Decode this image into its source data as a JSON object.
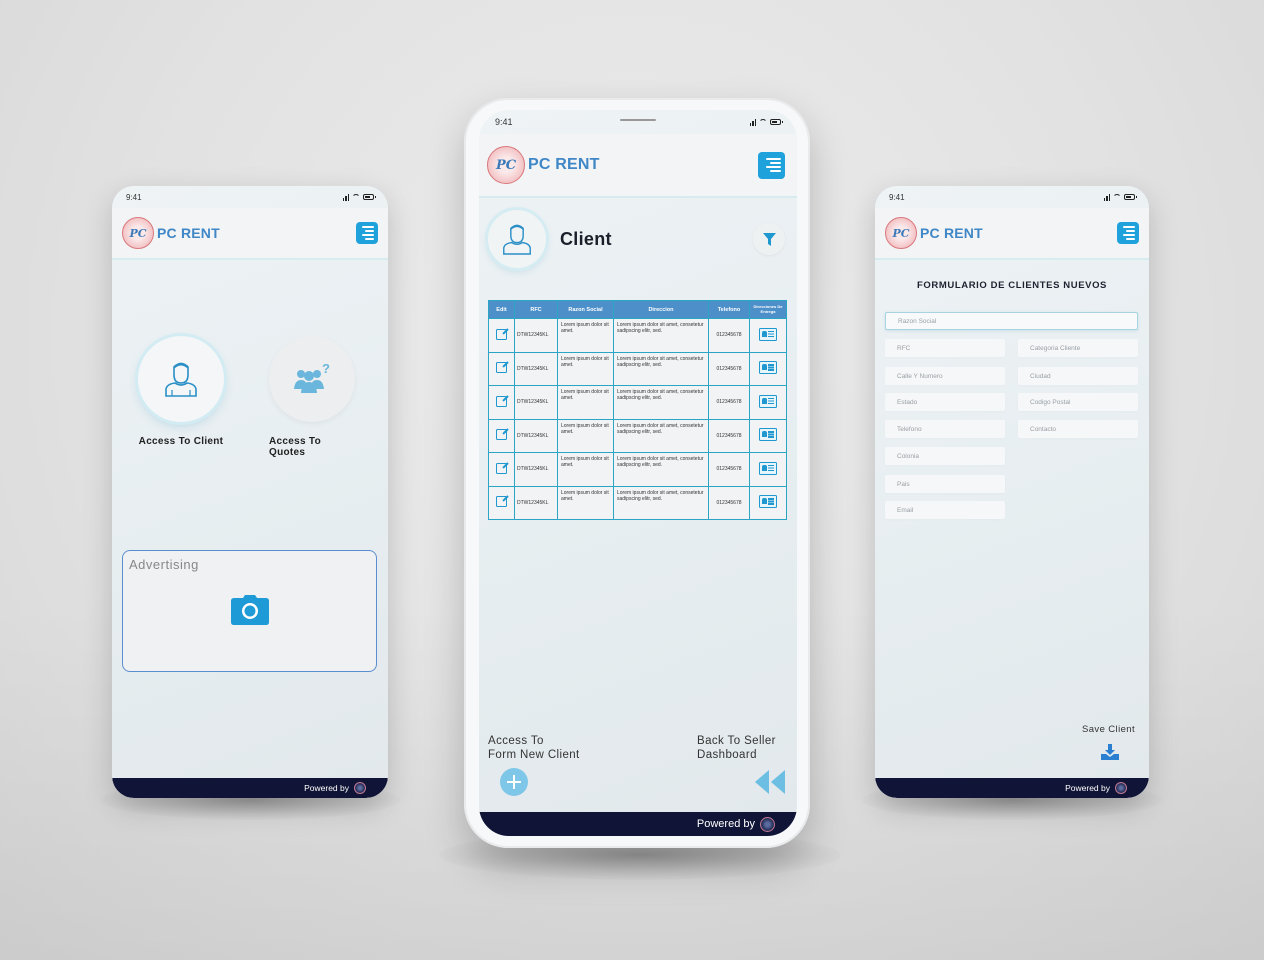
{
  "brand": {
    "name": "PC RENT",
    "logo_monogram": "PC",
    "accent_color": "#1fa2dc",
    "footer_color": "#101436"
  },
  "status_bar": {
    "time": "9:41"
  },
  "footer": {
    "powered_by": "Powered by"
  },
  "phones": {
    "home": {
      "menu_icon": "menu-icon",
      "buttons": [
        {
          "label": "Access To Client",
          "icon": "user-icon",
          "active": true
        },
        {
          "label": "Access To Quotes",
          "icon": "group-question-icon",
          "active": false
        }
      ],
      "advertising": {
        "label": "Advertising",
        "icon": "camera-icon"
      }
    },
    "client": {
      "title": "Client",
      "filter_icon": "filter-icon",
      "table": {
        "columns": [
          "Edit",
          "RFC",
          "Razon Social",
          "Direccion",
          "Telefono",
          "Direcciones De Entrega"
        ],
        "rows": [
          {
            "rfc": "DTW12345KL",
            "razon_social": "Lorem ipsum dolor sit amet.",
            "direccion": "Lorem ipsum dolor sit amet, consetetur sadipscing elitr, sed.",
            "telefono": "012345678"
          },
          {
            "rfc": "DTW12345KL",
            "razon_social": "Lorem ipsum dolor sit amet.",
            "direccion": "Lorem ipsum dolor sit amet, consetetur sadipscing elitr, sed.",
            "telefono": "012345678"
          },
          {
            "rfc": "DTW12345KL",
            "razon_social": "Lorem ipsum dolor sit amet.",
            "direccion": "Lorem ipsum dolor sit amet, consetetur sadipscing elitr, sed.",
            "telefono": "012345678"
          },
          {
            "rfc": "DTW12345KL",
            "razon_social": "Lorem ipsum dolor sit amet.",
            "direccion": "Lorem ipsum dolor sit amet, consetetur sadipscing elitr, sed.",
            "telefono": "012345678"
          },
          {
            "rfc": "DTW12345KL",
            "razon_social": "Lorem ipsum dolor sit amet.",
            "direccion": "Lorem ipsum dolor sit amet, consetetur sadipscing elitr, sed.",
            "telefono": "012345678"
          },
          {
            "rfc": "DTW12345KL",
            "razon_social": "Lorem ipsum dolor sit amet.",
            "direccion": "Lorem ipsum dolor sit amet, consetetur sadipscing elitr, sed.",
            "telefono": "012345678"
          }
        ]
      },
      "new_client": {
        "line1": "Access To",
        "line2": "Form New Client",
        "icon": "plus-icon"
      },
      "back": {
        "line1": "Back To Seller",
        "line2": "Dashboard",
        "icon": "rewind-icon"
      }
    },
    "form": {
      "title": "FORMULARIO DE CLIENTES NUEVOS",
      "fields": {
        "razon_social": "Razon Social",
        "rfc": "RFC",
        "categoria_cliente": "Categoria Cliente",
        "calle_y_numero": "Calle Y Numero",
        "ciudad": "Ciudad",
        "estado": "Estado",
        "codigo_postal": "Codigo Postal",
        "telefono": "Telefono",
        "contacto": "Contacto",
        "colonia": "Colonia",
        "pais": "Pais",
        "email": "Email"
      },
      "save": {
        "label": "Save Client",
        "icon": "download-icon"
      }
    }
  }
}
